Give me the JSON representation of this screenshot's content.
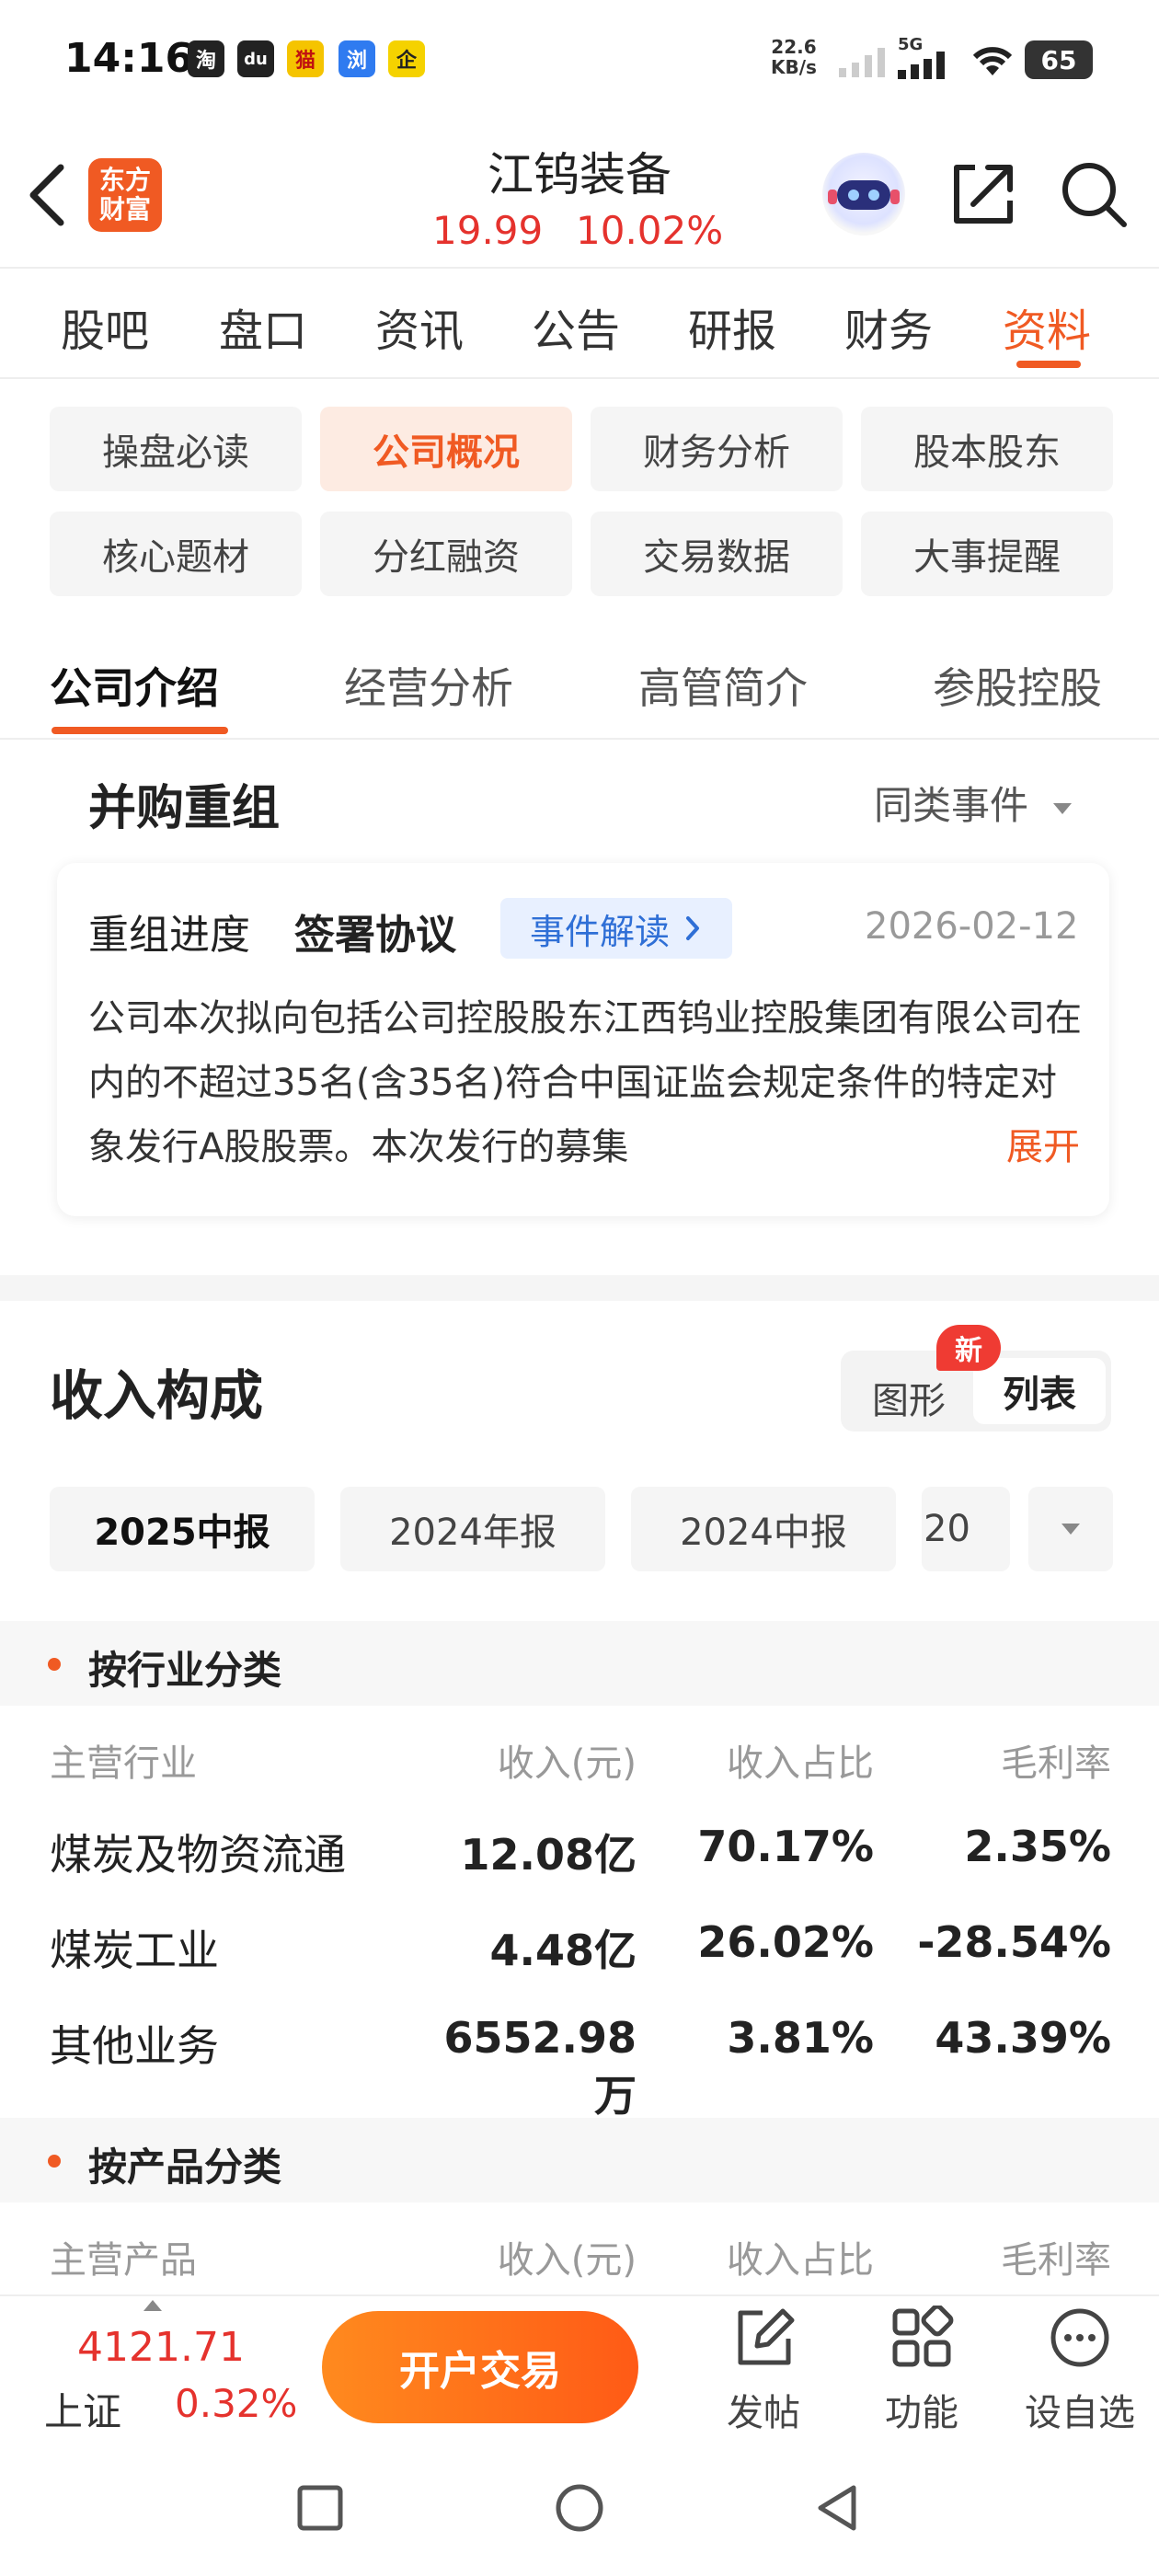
{
  "status_bar": {
    "time": "14:16",
    "app_icons": [
      "淘",
      "du",
      "猫",
      "浏",
      "企"
    ],
    "net_speed": "22.6",
    "net_unit": "KB/s",
    "network": "5G",
    "battery": "65"
  },
  "header": {
    "logo_line1": "东方",
    "logo_line2": "财富",
    "stock_name": "江钨装备",
    "price": "19.99",
    "change_pct": "10.02%"
  },
  "tabs": [
    "股吧",
    "盘口",
    "资讯",
    "公告",
    "研报",
    "财务",
    "资料"
  ],
  "active_tab": "资料",
  "sub_tabs": [
    "操盘必读",
    "公司概况",
    "财务分析",
    "股本股东",
    "核心题材",
    "分红融资",
    "交易数据",
    "大事提醒"
  ],
  "active_sub_tab": "公司概况",
  "section_tabs": [
    "公司介绍",
    "经营分析",
    "高管简介",
    "参股控股"
  ],
  "active_section_tab": "公司介绍",
  "merger": {
    "title": "并购重组",
    "filter": "同类事件",
    "progress_label": "重组进度",
    "progress_value": "签署协议",
    "event_button": "事件解读",
    "date": "2026-02-12",
    "description": "公司本次拟向包括公司控股股东江西钨业控股集团有限公司在内的不超过35名(含35名)符合中国证监会规定条件的特定对象发行A股股票。本次发行的募集",
    "expand": "展开"
  },
  "revenue": {
    "title": "收入构成",
    "toggle_chart": "图形",
    "toggle_list": "列表",
    "new_badge": "新",
    "periods": [
      "2025中报",
      "2024年报",
      "2024中报",
      "20"
    ],
    "active_period": "2025中报",
    "by_industry": {
      "label": "按行业分类",
      "headers": [
        "主营行业",
        "收入(元)",
        "收入占比",
        "毛利率"
      ],
      "rows": [
        [
          "煤炭及物资流通",
          "12.08亿",
          "70.17%",
          "2.35%"
        ],
        [
          "煤炭工业",
          "4.48亿",
          "26.02%",
          "-28.54%"
        ],
        [
          "其他业务",
          "6552.98万",
          "3.81%",
          "43.39%"
        ]
      ]
    },
    "by_product": {
      "label": "按产品分类",
      "headers": [
        "主营产品",
        "收入(元)",
        "收入占比",
        "毛利率"
      ]
    }
  },
  "bottom_bar": {
    "index_value": "4121.71",
    "index_name": "上证",
    "index_change": "0.32%",
    "trade_button": "开户交易",
    "post": "发帖",
    "features": "功能",
    "add_watchlist": "设自选"
  },
  "colors": {
    "accent": "#f05a23",
    "up_red": "#e5322d",
    "link_blue": "#2f6fd6"
  }
}
